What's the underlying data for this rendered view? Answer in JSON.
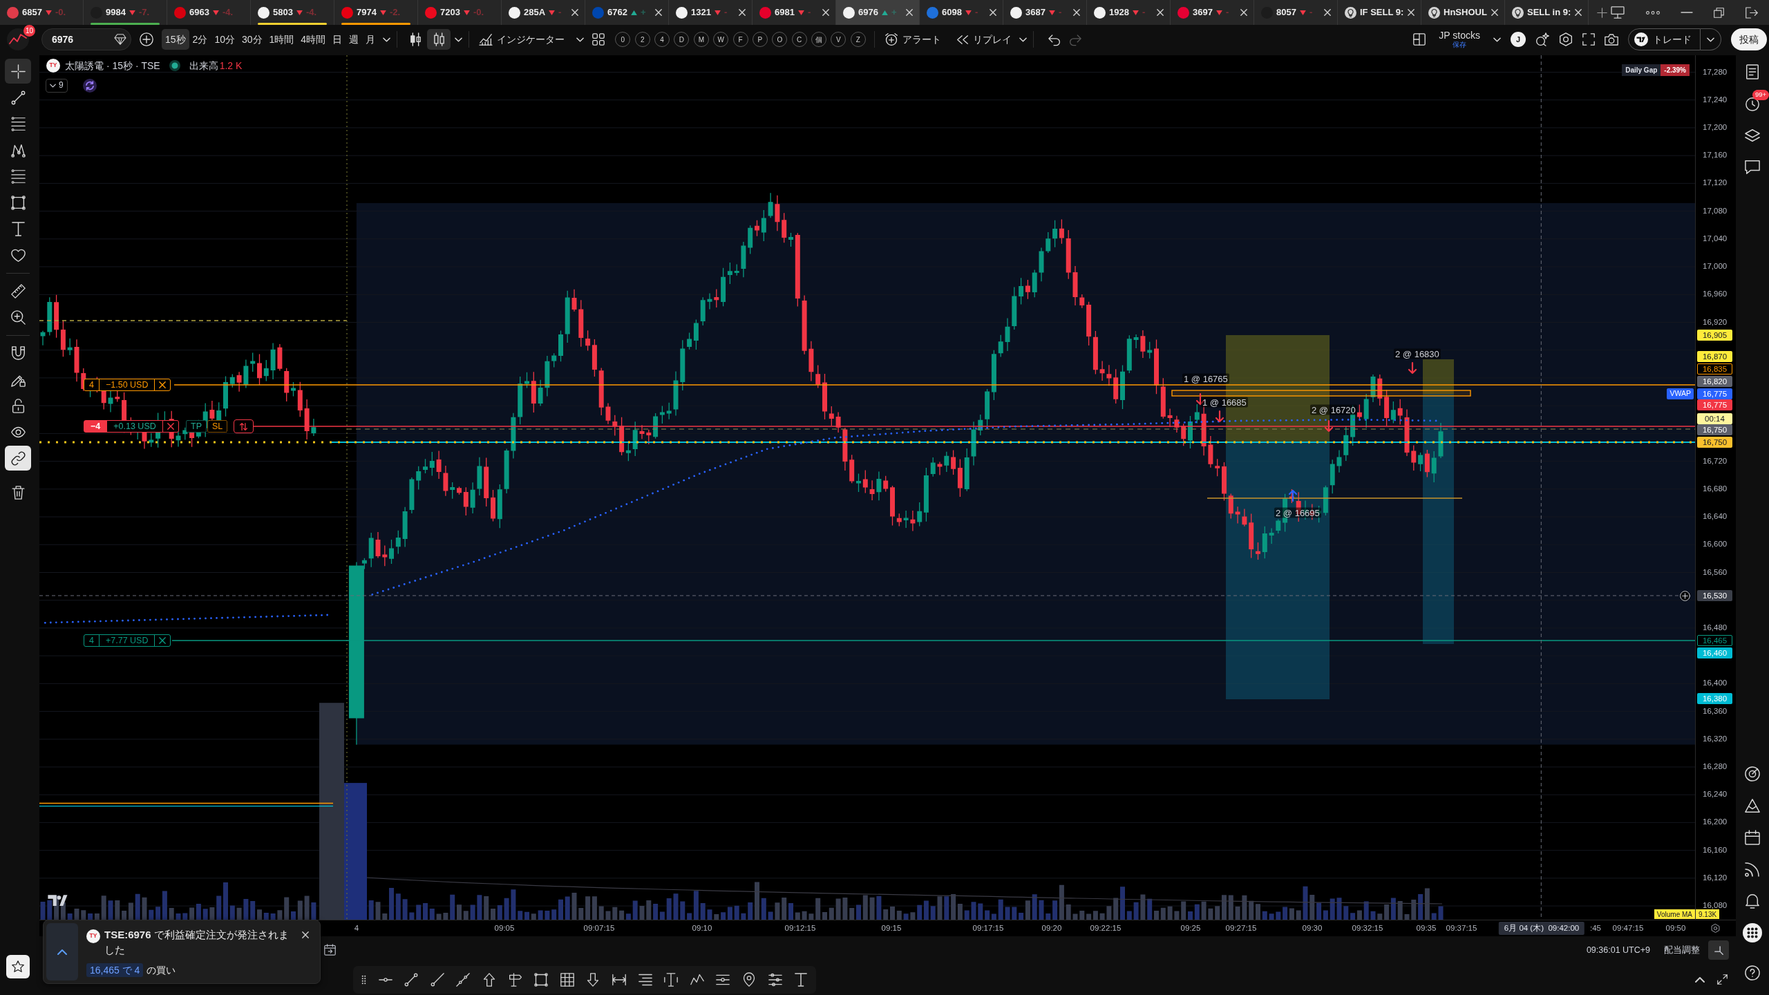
{
  "tabs": [
    {
      "kind": "symbol",
      "symbol": "6857",
      "rising": false,
      "change": "-0.",
      "selected": false,
      "closable": false
    },
    {
      "kind": "symbol",
      "symbol": "9984",
      "rising": false,
      "change": "-7.",
      "selected": false,
      "closable": false,
      "color": "#4caf50"
    },
    {
      "kind": "symbol",
      "symbol": "6963",
      "rising": false,
      "change": "-4.",
      "selected": false,
      "closable": false
    },
    {
      "kind": "symbol",
      "symbol": "5803",
      "rising": false,
      "change": "-4.",
      "selected": false,
      "closable": false,
      "color": "#f5d130"
    },
    {
      "kind": "symbol",
      "symbol": "7974",
      "rising": false,
      "change": "-2.",
      "selected": false,
      "closable": false,
      "color": "#ff9800"
    },
    {
      "kind": "symbol",
      "symbol": "7203",
      "rising": false,
      "change": "-0.",
      "selected": false,
      "closable": false
    },
    {
      "kind": "symbol",
      "symbol": "285A",
      "rising": false,
      "change": "-",
      "selected": false,
      "closable": true
    },
    {
      "kind": "symbol",
      "symbol": "6762",
      "rising": true,
      "change": "+",
      "selected": false,
      "closable": true
    },
    {
      "kind": "symbol",
      "symbol": "1321",
      "rising": false,
      "change": "-",
      "selected": false,
      "closable": true
    },
    {
      "kind": "symbol",
      "symbol": "6981",
      "rising": false,
      "change": "-",
      "selected": false,
      "closable": true
    },
    {
      "kind": "symbol",
      "symbol": "6976",
      "rising": true,
      "change": "+",
      "selected": true,
      "closable": true
    },
    {
      "kind": "symbol",
      "symbol": "6098",
      "rising": false,
      "change": "-",
      "selected": false,
      "closable": true
    },
    {
      "kind": "symbol",
      "symbol": "3687",
      "rising": false,
      "change": "-",
      "selected": false,
      "closable": true
    },
    {
      "kind": "symbol",
      "symbol": "1928",
      "rising": false,
      "change": "-",
      "selected": false,
      "closable": true
    },
    {
      "kind": "symbol",
      "symbol": "3697",
      "rising": false,
      "change": "-",
      "selected": false,
      "closable": true
    },
    {
      "kind": "symbol",
      "symbol": "8057",
      "rising": false,
      "change": "-",
      "selected": false,
      "closable": true
    },
    {
      "kind": "idea",
      "title": "IF SELL 9:",
      "selected": false,
      "closable": true
    },
    {
      "kind": "idea",
      "title": "HnSHOUL",
      "selected": false,
      "closable": true
    },
    {
      "kind": "idea",
      "title": "SELL in 9:",
      "selected": false,
      "closable": true
    }
  ],
  "toolbar": {
    "notifications": "10",
    "symbol": "6976",
    "intervals": [
      {
        "label": "15秒",
        "selected": true
      },
      {
        "label": "2分",
        "selected": false
      },
      {
        "label": "10分",
        "selected": false
      },
      {
        "label": "30分",
        "selected": false
      },
      {
        "label": "1時間",
        "selected": false
      },
      {
        "label": "4時間",
        "selected": false
      },
      {
        "label": "日",
        "selected": false
      },
      {
        "label": "週",
        "selected": false
      },
      {
        "label": "月",
        "selected": false
      }
    ],
    "chart_styles": [
      {
        "kind": "candles",
        "selected": false
      },
      {
        "kind": "hollow-candles",
        "selected": true
      }
    ],
    "indicators": "インジケーター",
    "quick_buttons": [
      "0",
      "2",
      "4",
      "D",
      "M",
      "W",
      "F",
      "P",
      "O",
      "C",
      "個",
      "V",
      "Z"
    ],
    "alert": "アラート",
    "replay": "リプレイ",
    "history": [
      {
        "kind": "undo",
        "disabled": false
      },
      {
        "kind": "redo",
        "disabled": true
      }
    ],
    "layout_name": "JP stocks",
    "layout_status": "保存",
    "user_initial": "J",
    "trade": "トレード",
    "publish": "投稿"
  },
  "left_toolbar": {
    "tools": [
      {
        "kind": "crosshair",
        "selected": true
      },
      {
        "kind": "trend-line",
        "selected": false
      },
      {
        "kind": "fib",
        "selected": false
      },
      {
        "kind": "pattern",
        "selected": false
      },
      {
        "kind": "forecast",
        "selected": false
      },
      {
        "kind": "rectangle",
        "selected": false
      },
      {
        "kind": "text",
        "selected": false
      },
      {
        "kind": "heart",
        "selected": false
      },
      {
        "kind": "ruler",
        "selected": false
      },
      {
        "kind": "zoom",
        "selected": false
      }
    ],
    "toggles": [
      {
        "kind": "magnet",
        "on": false
      },
      {
        "kind": "pencil-lock",
        "on": false
      },
      {
        "kind": "lock",
        "on": false
      },
      {
        "kind": "eye",
        "on": false
      },
      {
        "kind": "link",
        "on": true
      }
    ]
  },
  "right_toolbar": {
    "alerts_badge": "99+"
  },
  "chart": {
    "logo": "TY",
    "title": "太陽誘電 · 15秒 · TSE",
    "market_open": true,
    "volume_label": "出来高",
    "volume_value": "1.2 K",
    "indicator_count": "9",
    "daily_gap_label": "Daily Gap",
    "daily_gap_value": "-2.39%",
    "order_lines": [
      {
        "kind": "order",
        "quantity": "4",
        "pnl": "−1.50 USD",
        "color": "#ff9800"
      },
      {
        "kind": "position",
        "quantity": "−4",
        "pnl": "+0.13 USD",
        "take_profit": "TP",
        "stop_loss": "SL",
        "color": "#f23645"
      },
      {
        "kind": "order",
        "quantity": "4",
        "pnl": "+7.77 USD",
        "color": "#089981"
      }
    ],
    "executions": [
      {
        "label": "1 @ 16765",
        "kind": "sell"
      },
      {
        "label": "1 @ 16685",
        "kind": "sell"
      },
      {
        "label": "2 @ 16720",
        "kind": "sell"
      },
      {
        "label": "2 @ 16830",
        "kind": "sell"
      },
      {
        "label": "2 @ 16695",
        "kind": "buy"
      }
    ],
    "price_axis": [
      "17,280",
      "17,240",
      "17,200",
      "17,160",
      "17,120",
      "17,080",
      "17,040",
      "17,000",
      "16,960",
      "16,920",
      "16,720",
      "16,680",
      "16,640",
      "16,600",
      "16,560",
      "16,480",
      "16,400",
      "16,360",
      "16,320",
      "16,280",
      "16,240",
      "16,200",
      "16,160",
      "16,120",
      "16,080"
    ],
    "price_labels": [
      {
        "text": "16,905",
        "kind": "filled",
        "color": "#ffeb3b"
      },
      {
        "text": "16,870",
        "kind": "filled",
        "color": "#ffeb3b"
      },
      {
        "text": "16,835",
        "kind": "outline",
        "color": "#ff9800"
      },
      {
        "text": "16,820",
        "kind": "filled",
        "color": "#5d606b"
      },
      {
        "text": "16,775",
        "kind": "filled",
        "color": "#2962ff",
        "tag": "VWAP"
      },
      {
        "text": "16,775",
        "kind": "filled",
        "color": "#f23645"
      },
      {
        "text": "00:14",
        "kind": "filled",
        "color": "#fff59d"
      },
      {
        "text": "16,750",
        "kind": "filled",
        "color": "#5d606b"
      },
      {
        "text": "16,750",
        "kind": "filled",
        "color": "#fbc02d"
      },
      {
        "text": "16,530",
        "kind": "crosshair",
        "color": "#3a3e48"
      },
      {
        "text": "16,465",
        "kind": "outline",
        "color": "#089981"
      },
      {
        "text": "16,460",
        "kind": "filled",
        "color": "#00bcd4"
      },
      {
        "text": "16,380",
        "kind": "filled",
        "color": "#00bcd4"
      }
    ],
    "volume_ma_label": "Volume MA",
    "volume_ma_value": "9.13K",
    "time_axis": [
      "4",
      "09:05",
      "09:07:15",
      "09:10",
      "09:12:15",
      "09:15",
      "09:17:15",
      "09:20",
      "09:22:15",
      "09:25",
      "09:27:15",
      "09:30",
      "09:32:15",
      "09:35",
      "09:37:15",
      ":45",
      "09:47:15",
      "09:50"
    ],
    "crosshair_time": "6月 04 (木)  09:42:00"
  },
  "notification": {
    "logo": "TY",
    "message": "**TSE:6976** で利益確定注文が発注されました",
    "detail": "16,465 で 4",
    "detail_suffix": "の買い"
  },
  "status_bar": {
    "time": "09:36:01 UTC+9",
    "dividend_adjustment": "配当調整"
  }
}
